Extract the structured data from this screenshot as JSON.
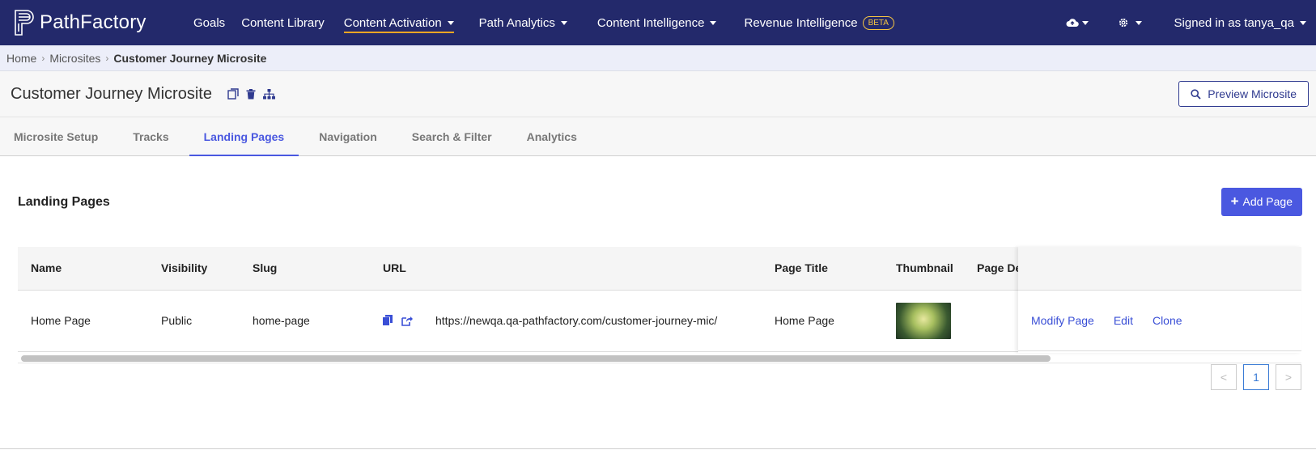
{
  "app": {
    "brand": "PathFactory",
    "nav": [
      {
        "label": "Goals"
      },
      {
        "label": "Content Library"
      },
      {
        "label": "Content Activation"
      },
      {
        "label": "Path Analytics"
      },
      {
        "label": "Content Intelligence"
      },
      {
        "label": "Revenue Intelligence",
        "badge": "BETA"
      }
    ],
    "user_label": "Signed in as tanya_qa"
  },
  "breadcrumb": {
    "home": "Home",
    "microsites": "Microsites",
    "current": "Customer Journey Microsite"
  },
  "page": {
    "title": "Customer Journey Microsite",
    "preview_label": "Preview Microsite"
  },
  "tabs": [
    {
      "label": "Microsite Setup"
    },
    {
      "label": "Tracks"
    },
    {
      "label": "Landing Pages",
      "active": true
    },
    {
      "label": "Navigation"
    },
    {
      "label": "Search & Filter"
    },
    {
      "label": "Analytics"
    }
  ],
  "section": {
    "title": "Landing Pages",
    "add_label": "Add Page"
  },
  "table": {
    "columns": [
      "Name",
      "Visibility",
      "Slug",
      "URL",
      "Page Title",
      "Thumbnail",
      "Page De"
    ],
    "rows": [
      {
        "name": "Home Page",
        "visibility": "Public",
        "slug": "home-page",
        "url": "https://newqa.qa-pathfactory.com/customer-journey-mic/",
        "page_title": "Home Page",
        "actions": [
          "Modify Page",
          "Edit",
          "Clone"
        ]
      }
    ]
  },
  "pagination": {
    "current": "1",
    "prev": "<",
    "next": ">"
  },
  "colors": {
    "nav_bg": "#23296b",
    "accent": "#4a58e0",
    "active_underline": "#f5a623",
    "beta": "#f5c542"
  }
}
